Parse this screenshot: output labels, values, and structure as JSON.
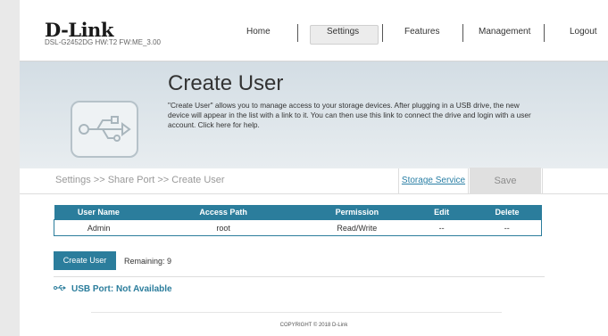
{
  "header": {
    "logo": "D-Link",
    "model": "DSL-G2452DG  HW:T2  FW:ME_3.00",
    "nav": [
      "Home",
      "Settings",
      "Features",
      "Management",
      "Logout"
    ],
    "active_nav": "Settings"
  },
  "banner": {
    "title": "Create User",
    "description": "\"Create User\" allows you to manage access to your storage devices. After plugging in a USB drive, the new device will appear in the list with a link to it. You can then use this link to connect the drive and login with a user account. Click here for help."
  },
  "breadcrumb": "Settings >> Share Port >> Create User",
  "actions": {
    "storage_service": "Storage Service",
    "save": "Save"
  },
  "table": {
    "headers": [
      "User Name",
      "Access Path",
      "Permission",
      "Edit",
      "Delete"
    ],
    "rows": [
      [
        "Admin",
        "root",
        "Read/Write",
        "--",
        "--"
      ]
    ]
  },
  "create_user": {
    "label": "Create User",
    "remaining": "Remaining: 9"
  },
  "usb_port": {
    "icon": "usb-icon",
    "label": "USB Port: Not Available"
  },
  "footer": {
    "copyright": "COPYRIGHT © 2018 D-Link"
  },
  "colors": {
    "accent": "#2b7d9c",
    "banner": "#dde4e8"
  }
}
